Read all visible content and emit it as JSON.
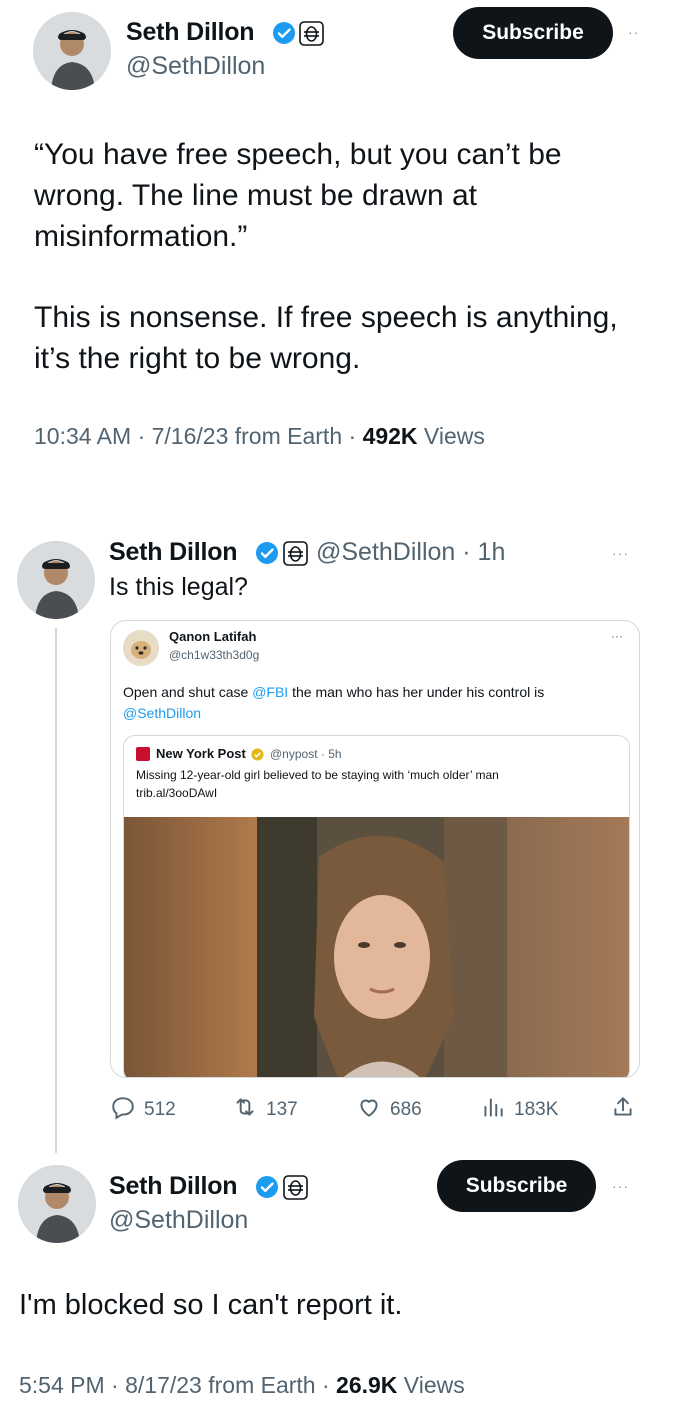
{
  "tweet1": {
    "name": "Seth Dillon",
    "handle": "@SethDillon",
    "subscribe_label": "Subscribe",
    "more": "··",
    "quote_line": "“You have free speech, but you can’t be wrong. The line must be drawn at misinformation.”",
    "body_line": "This is nonsense. If free speech is anything, it’s the right to be wrong.",
    "time_date": "10:34 AM · 7/16/23 from Earth · ",
    "views_count": "492K",
    "views_label": " Views"
  },
  "reply1": {
    "name": "Seth Dillon",
    "handle_time": "@SethDillon · 1h",
    "more": "···",
    "text": "Is this legal?",
    "quoted": {
      "name": "Qanon Latifah",
      "handle": "@ch1w33th3d0g",
      "more": "···",
      "text_pre": "Open and shut case ",
      "mention_fbi": "@FBI",
      "text_mid": " the man who has her under his control is ",
      "mention_seth": "@SethDillon",
      "inner": {
        "source": "New York Post",
        "handle_time": "@nypost · 5h",
        "headline": "Missing 12-year-old girl believed to be staying with ‘much older’ man",
        "link": "trib.al/3ooDAwI"
      }
    },
    "actions": {
      "replies": "512",
      "retweets": "137",
      "likes": "686",
      "views": "183K"
    }
  },
  "tweet2": {
    "name": "Seth Dillon",
    "handle": "@SethDillon",
    "subscribe_label": "Subscribe",
    "more": "···",
    "text": "I'm blocked so I can't report it.",
    "time_date": "5:54 PM · 8/17/23 from Earth · ",
    "views_count": "26.9K",
    "views_label": " Views"
  },
  "colors": {
    "verified_blue": "#1d9bf0",
    "link_blue": "#1d9bf0",
    "text_primary": "#0f1419",
    "text_secondary": "#536471",
    "border": "#cfd9de"
  },
  "icons": [
    "verified-badge-icon",
    "babylon-bee-badge-icon",
    "reply-icon",
    "retweet-icon",
    "like-icon",
    "views-icon",
    "share-icon"
  ]
}
